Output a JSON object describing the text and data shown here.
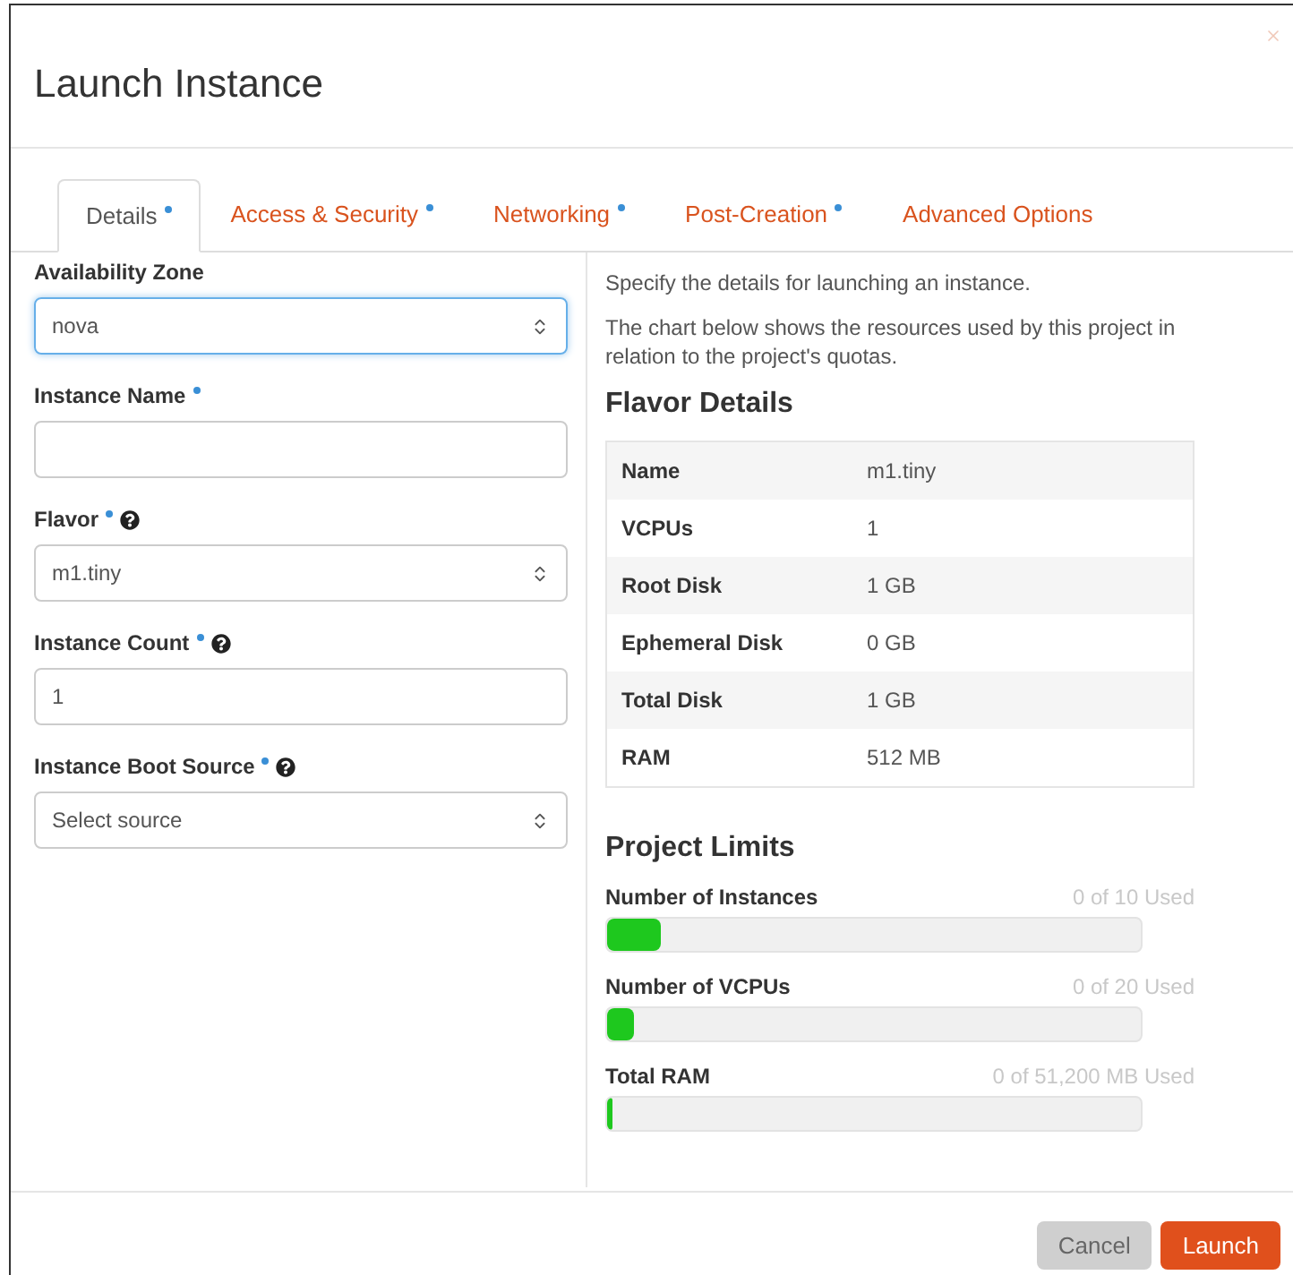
{
  "window": {
    "title": "Launch Instance"
  },
  "tabs": [
    {
      "label": "Details",
      "required": true,
      "selected": true
    },
    {
      "label": "Access & Security",
      "required": true,
      "selected": false
    },
    {
      "label": "Networking",
      "required": true,
      "selected": false
    },
    {
      "label": "Post-Creation",
      "required": true,
      "selected": false
    },
    {
      "label": "Advanced Options",
      "required": false,
      "selected": false
    }
  ],
  "form": [
    {
      "kind": "select",
      "label": "Availability Zone",
      "required": false,
      "help": false,
      "value": "nova",
      "focused": true
    },
    {
      "kind": "text",
      "label": "Instance Name",
      "required": true,
      "help": false,
      "focused": false
    },
    {
      "kind": "select",
      "label": "Flavor",
      "required": true,
      "help": true,
      "value": "m1.tiny",
      "focused": false
    },
    {
      "kind": "text",
      "label": "Instance Count",
      "required": true,
      "help": true,
      "value": "1",
      "focused": false
    },
    {
      "kind": "select",
      "label": "Instance Boot Source",
      "required": true,
      "help": true,
      "value": "Select source",
      "focused": false
    }
  ],
  "info": [
    "Specify the details for launching an instance.",
    "The chart below shows the resources used by this project in relation to the project's quotas."
  ],
  "flavor_details": {
    "title": "Flavor Details",
    "rows": [
      {
        "name": "Name",
        "value": "m1.tiny"
      },
      {
        "name": "VCPUs",
        "value": "1"
      },
      {
        "name": "Root Disk",
        "value": "1 GB"
      },
      {
        "name": "Ephemeral Disk",
        "value": "0 GB"
      },
      {
        "name": "Total Disk",
        "value": "1 GB"
      },
      {
        "name": "RAM",
        "value": "512 MB"
      }
    ]
  },
  "project_limits": {
    "title": "Project Limits",
    "items": [
      {
        "name": "Number of Instances",
        "reading": "0 of 10 Used",
        "level": 0.1
      },
      {
        "name": "Number of VCPUs",
        "reading": "0 of 20 Used",
        "level": 0.05
      },
      {
        "name": "Total RAM",
        "reading": "0 of 51,200 MB Used",
        "level": 0.01
      }
    ]
  },
  "buttons": [
    {
      "label": "Cancel",
      "kind": "secondary"
    },
    {
      "label": "Launch",
      "kind": "primary"
    }
  ]
}
